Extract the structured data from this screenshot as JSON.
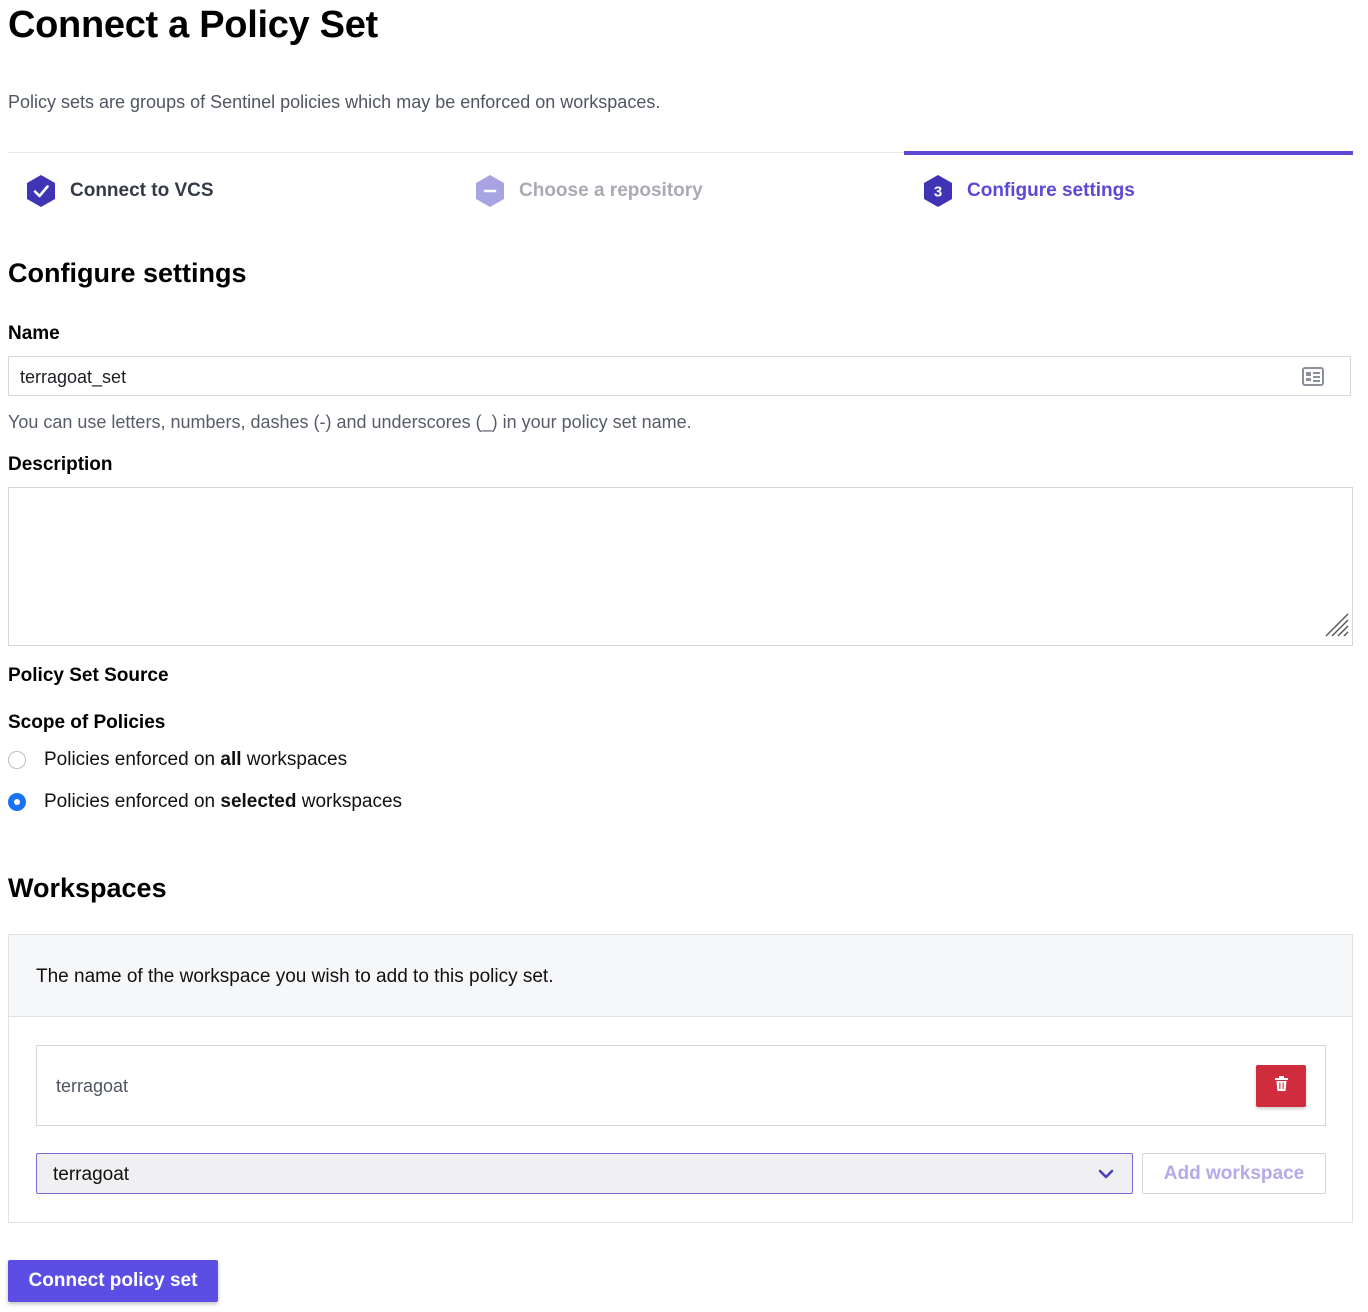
{
  "header": {
    "title": "Connect a Policy Set",
    "subtitle": "Policy sets are groups of Sentinel policies which may be enforced on workspaces."
  },
  "stepper": {
    "steps": [
      {
        "label": "Connect to VCS",
        "state": "complete",
        "icon": "check-icon"
      },
      {
        "label": "Choose a repository",
        "state": "skipped",
        "icon": "minus-icon"
      },
      {
        "label": "Configure settings",
        "state": "active",
        "number": "3"
      }
    ],
    "colors": {
      "complete": "#3f34b5",
      "skipped": "#a8a4e3",
      "active": "#3f34b5",
      "active_bar": "#5f49d4"
    }
  },
  "form": {
    "section_title": "Configure settings",
    "name": {
      "label": "Name",
      "value": "terragoat_set",
      "hint": "You can use letters, numbers, dashes (-) and underscores (_) in your policy set name."
    },
    "description": {
      "label": "Description",
      "value": ""
    },
    "policy_set_source_label": "Policy Set Source",
    "scope": {
      "label": "Scope of Policies",
      "options": [
        {
          "pre": "Policies enforced on ",
          "bold": "all",
          "post": " workspaces",
          "checked": false
        },
        {
          "pre": "Policies enforced on ",
          "bold": "selected",
          "post": " workspaces",
          "checked": true
        }
      ]
    }
  },
  "workspaces": {
    "section_title": "Workspaces",
    "panel_text": "The name of the workspace you wish to add to this policy set.",
    "items": [
      {
        "name": "terragoat"
      }
    ],
    "select_value": "terragoat",
    "add_button_label": "Add workspace"
  },
  "submit_label": "Connect policy set",
  "colors": {
    "accent": "#5c4ee5",
    "danger": "#cf2c3d",
    "radio_checked": "#1a73f0"
  }
}
